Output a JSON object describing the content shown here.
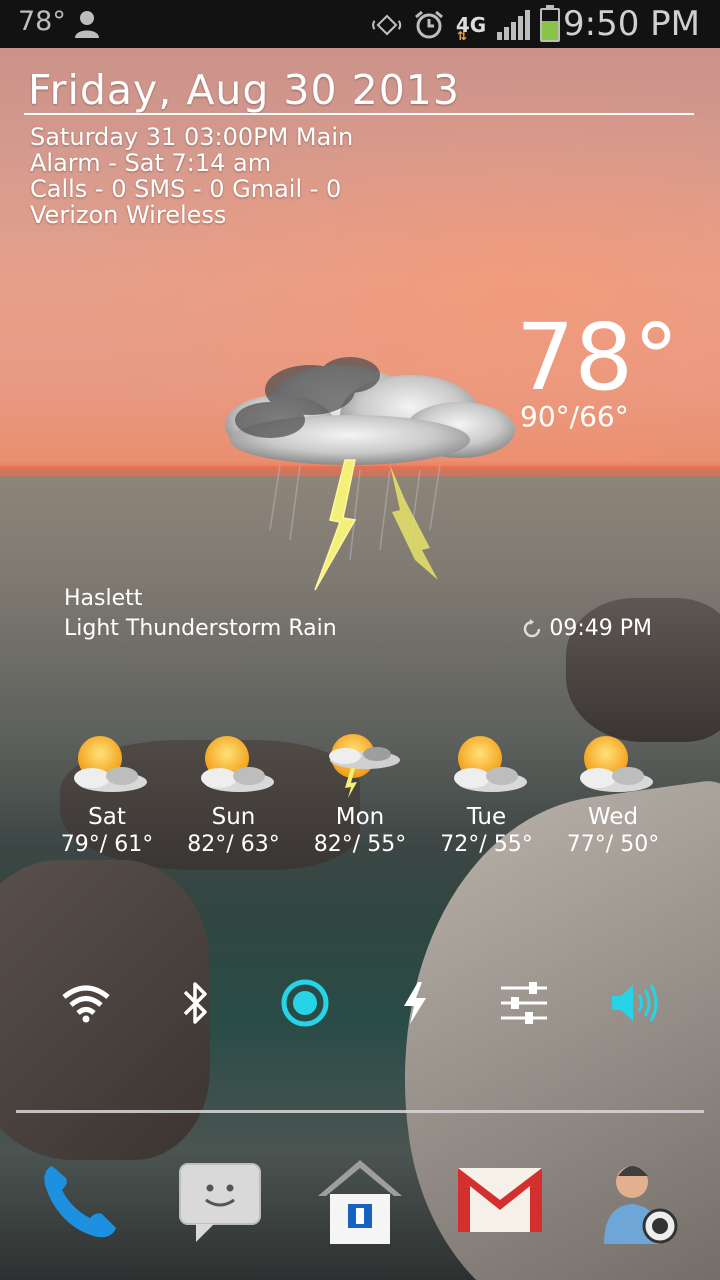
{
  "status_bar": {
    "temp": "78°",
    "time": "9:50 PM",
    "network": "4G",
    "network_sub": "LTE",
    "battery_level": 0.65
  },
  "widget": {
    "date": "Friday, Aug 30 2013",
    "event": "Saturday 31  03:00PM  Main",
    "alarm": "Alarm -  Sat 7:14 am",
    "counts": "Calls - 0  SMS - 0  Gmail - 0",
    "carrier": "Verizon Wireless"
  },
  "weather": {
    "current_temp": "78°",
    "hi_lo": "90°/66°",
    "location": "Haslett",
    "condition": "Light Thunderstorm Rain",
    "updated": "09:49 PM",
    "forecast": [
      {
        "day": "Sat",
        "temps": "79°/ 61°",
        "icon": "partly-cloudy-icon"
      },
      {
        "day": "Sun",
        "temps": "82°/ 63°",
        "icon": "partly-cloudy-icon"
      },
      {
        "day": "Mon",
        "temps": "82°/ 55°",
        "icon": "thunderstorm-icon"
      },
      {
        "day": "Tue",
        "temps": "72°/ 55°",
        "icon": "partly-cloudy-icon"
      },
      {
        "day": "Wed",
        "temps": "77°/ 50°",
        "icon": "partly-cloudy-icon"
      }
    ]
  },
  "toggles": [
    {
      "name": "wifi-icon",
      "active": false
    },
    {
      "name": "bluetooth-icon",
      "active": false
    },
    {
      "name": "gps-icon",
      "active": true
    },
    {
      "name": "flashlight-icon",
      "active": false
    },
    {
      "name": "settings-sliders-icon",
      "active": false
    },
    {
      "name": "sound-icon",
      "active": true
    }
  ],
  "dock": [
    "phone-icon",
    "messaging-icon",
    "home-icon",
    "gmail-icon",
    "contacts-icon"
  ],
  "colors": {
    "accent": "#27d3e6",
    "battery": "#8bc34a"
  }
}
